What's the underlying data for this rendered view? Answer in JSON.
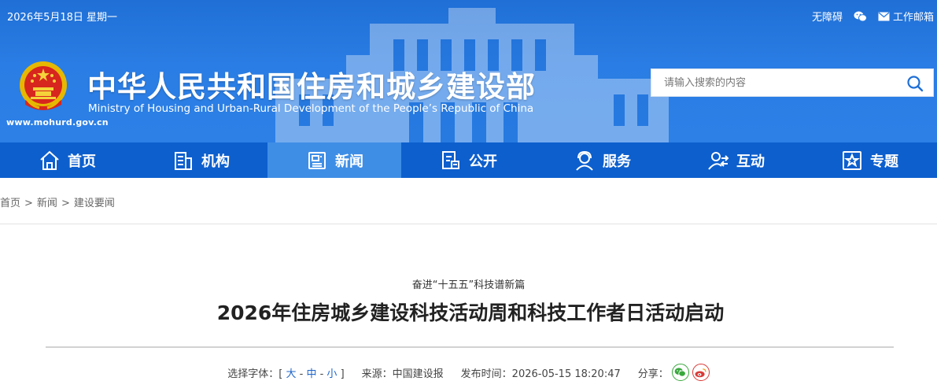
{
  "header": {
    "date": "2026年5月18日 星期一",
    "accessibility_label": "无障碍",
    "wechat_icon": "wechat-icon",
    "mail_label": "工作邮箱",
    "title_cn": "中华人民共和国住房和城乡建设部",
    "title_en": "Ministry of Housing and Urban-Rural Development of the People’s Republic of China",
    "site_url": "www.mohurd.gov.cn",
    "search_placeholder": "请输入搜索的内容"
  },
  "nav": {
    "items": [
      {
        "label": "首页",
        "icon": "home-icon"
      },
      {
        "label": "机构",
        "icon": "building-icon"
      },
      {
        "label": "新闻",
        "icon": "news-icon",
        "active": true
      },
      {
        "label": "公开",
        "icon": "document-icon"
      },
      {
        "label": "服务",
        "icon": "service-icon"
      },
      {
        "label": "互动",
        "icon": "interact-icon"
      },
      {
        "label": "专题",
        "icon": "star-icon"
      }
    ]
  },
  "breadcrumb": [
    "首页",
    "新闻",
    "建设要闻"
  ],
  "article": {
    "subtitle": "奋进“十五五”科技谱新篇",
    "title": "2026年住房城乡建设科技活动周和科技工作者日活动启动",
    "font_label": "选择字体：",
    "font_sizes": [
      "大",
      "中",
      "小"
    ],
    "source_label": "来源：中国建设报",
    "publish_label": "发布时间：2026-05-15 18:20:47",
    "share_label": "分享："
  },
  "colors": {
    "banner": "#2a7de4",
    "nav": "#0d5fcd",
    "nav_active": "#3f8ee6",
    "link": "#1e64c8"
  }
}
